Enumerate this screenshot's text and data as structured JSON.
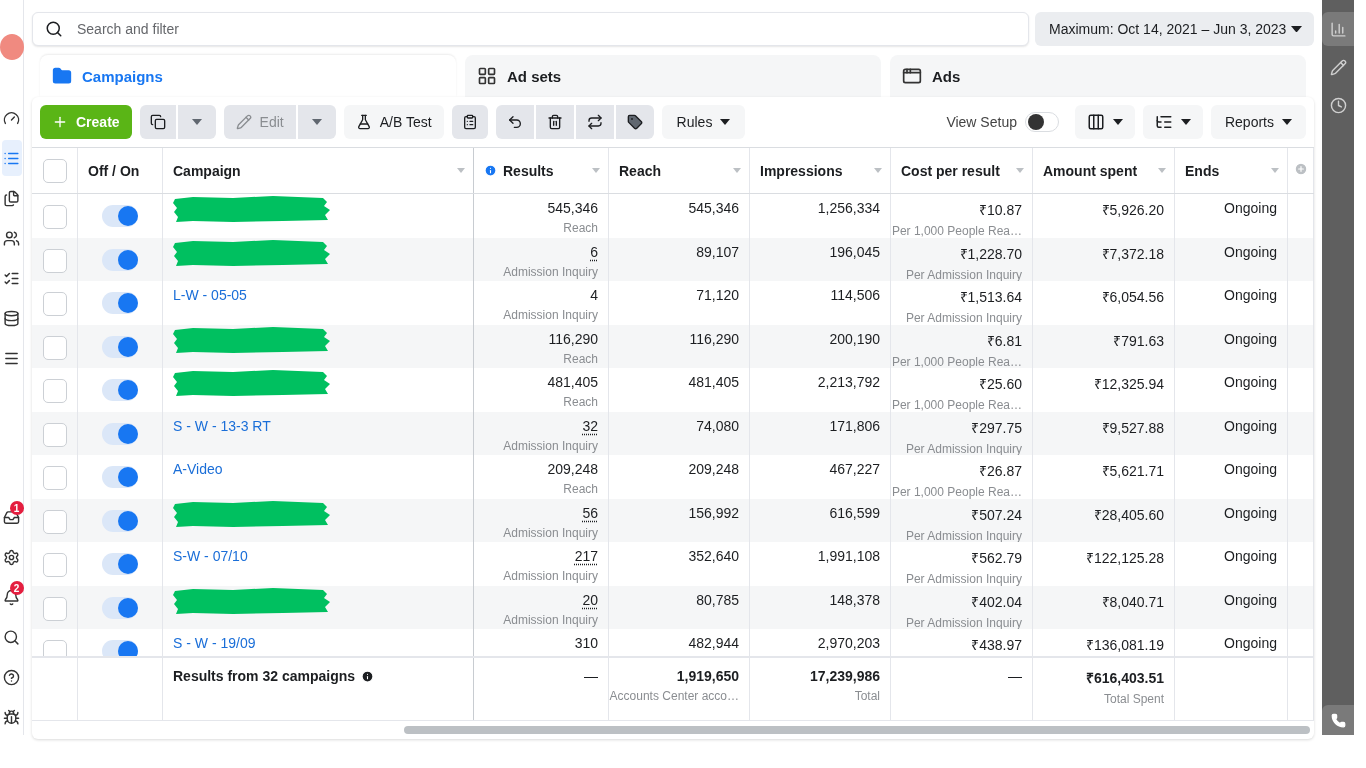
{
  "left_rail": {
    "items": [
      {
        "selected": false
      },
      {
        "selected": true
      },
      {
        "selected": false
      },
      {
        "selected": false
      },
      {
        "selected": false
      },
      {
        "selected": false
      },
      {
        "selected": false
      }
    ],
    "bottom_items": [
      {
        "selected": false,
        "badge": "1"
      },
      {
        "selected": false
      },
      {
        "selected": false,
        "badge": "2"
      },
      {
        "selected": false
      },
      {
        "selected": false
      },
      {
        "selected": false
      }
    ]
  },
  "search": {
    "placeholder": "Search and filter"
  },
  "date_range": "Maximum: Oct 14, 2021 – Jun 3, 2023",
  "tabs": [
    {
      "label": "Campaigns",
      "selected": true
    },
    {
      "label": "Ad sets",
      "selected": false
    },
    {
      "label": "Ads",
      "selected": false
    }
  ],
  "toolbar": {
    "create": "Create",
    "edit": "Edit",
    "ab_test": "A/B Test",
    "rules": "Rules",
    "view_setup": {
      "label": "View Setup",
      "on": false
    },
    "reports": "Reports"
  },
  "table": {
    "header_selected": false,
    "columns": [
      "Off / On",
      "Campaign",
      "Results",
      "Reach",
      "Impressions",
      "Cost per result",
      "Amount spent",
      "Ends"
    ],
    "rows": [
      {
        "selected": false,
        "on": true,
        "campaign": {
          "kind": "redacted"
        },
        "results": "545,346",
        "results_label": "Reach",
        "underlined": false,
        "reach": "545,346",
        "impressions": "1,256,334",
        "cost": "₹10.87",
        "cost_label": "Per 1,000 People Rea…",
        "amount": "₹5,926.20",
        "ends": "Ongoing"
      },
      {
        "selected": false,
        "on": true,
        "campaign": {
          "kind": "redacted"
        },
        "results": "6",
        "results_label": "Admission Inquiry",
        "underlined": true,
        "reach": "89,107",
        "impressions": "196,045",
        "cost": "₹1,228.70",
        "cost_label": "Per Admission Inquiry",
        "amount": "₹7,372.18",
        "ends": "Ongoing"
      },
      {
        "selected": false,
        "on": true,
        "campaign": {
          "kind": "link",
          "name": "L-W - 05-05"
        },
        "results": "4",
        "results_label": "Admission Inquiry",
        "underlined": false,
        "reach": "71,120",
        "impressions": "114,506",
        "cost": "₹1,513.64",
        "cost_label": "Per Admission Inquiry",
        "amount": "₹6,054.56",
        "ends": "Ongoing"
      },
      {
        "selected": false,
        "on": true,
        "campaign": {
          "kind": "redacted"
        },
        "results": "116,290",
        "results_label": "Reach",
        "underlined": false,
        "reach": "116,290",
        "impressions": "200,190",
        "cost": "₹6.81",
        "cost_label": "Per 1,000 People Rea…",
        "amount": "₹791.63",
        "ends": "Ongoing"
      },
      {
        "selected": false,
        "on": true,
        "campaign": {
          "kind": "redacted"
        },
        "results": "481,405",
        "results_label": "Reach",
        "underlined": false,
        "reach": "481,405",
        "impressions": "2,213,792",
        "cost": "₹25.60",
        "cost_label": "Per 1,000 People Rea…",
        "amount": "₹12,325.94",
        "ends": "Ongoing"
      },
      {
        "selected": false,
        "on": true,
        "campaign": {
          "kind": "link",
          "name": "S - W - 13-3 RT"
        },
        "results": "32",
        "results_label": "Admission Inquiry",
        "underlined": true,
        "reach": "74,080",
        "impressions": "171,806",
        "cost": "₹297.75",
        "cost_label": "Per Admission Inquiry",
        "amount": "₹9,527.88",
        "ends": "Ongoing"
      },
      {
        "selected": false,
        "on": true,
        "campaign": {
          "kind": "link",
          "name": "A-Video"
        },
        "results": "209,248",
        "results_label": "Reach",
        "underlined": false,
        "reach": "209,248",
        "impressions": "467,227",
        "cost": "₹26.87",
        "cost_label": "Per 1,000 People Rea…",
        "amount": "₹5,621.71",
        "ends": "Ongoing"
      },
      {
        "selected": false,
        "on": true,
        "campaign": {
          "kind": "redacted"
        },
        "results": "56",
        "results_label": "Admission Inquiry",
        "underlined": true,
        "reach": "156,992",
        "impressions": "616,599",
        "cost": "₹507.24",
        "cost_label": "Per Admission Inquiry",
        "amount": "₹28,405.60",
        "ends": "Ongoing"
      },
      {
        "selected": false,
        "on": true,
        "campaign": {
          "kind": "link",
          "name": "S-W - 07/10"
        },
        "results": "217",
        "results_label": "Admission Inquiry",
        "underlined": true,
        "reach": "352,640",
        "impressions": "1,991,108",
        "cost": "₹562.79",
        "cost_label": "Per Admission Inquiry",
        "amount": "₹122,125.28",
        "ends": "Ongoing"
      },
      {
        "selected": false,
        "on": true,
        "campaign": {
          "kind": "redacted"
        },
        "results": "20",
        "results_label": "Admission Inquiry",
        "underlined": true,
        "reach": "80,785",
        "impressions": "148,378",
        "cost": "₹402.04",
        "cost_label": "Per Admission Inquiry",
        "amount": "₹8,040.71",
        "ends": "Ongoing"
      },
      {
        "selected": false,
        "on": true,
        "campaign": {
          "kind": "link",
          "name": "S - W - 19/09"
        },
        "results": "310",
        "underlined": false,
        "reach": "482,944",
        "impressions": "2,970,203",
        "cost": "₹438.97",
        "amount": "₹136,081.19",
        "ends": "Ongoing"
      }
    ],
    "footer": {
      "label": "Results from 32 campaigns",
      "results": "—",
      "reach": "1,919,650",
      "reach_label": "Accounts Center acco…",
      "impressions": "17,239,986",
      "impressions_label": "Total",
      "cost": "—",
      "amount": "₹616,403.51",
      "amount_label": "Total Spent"
    }
  },
  "right_rail": {
    "items": [
      {
        "selected": true
      },
      {
        "selected": false
      },
      {
        "selected": false
      }
    ]
  }
}
